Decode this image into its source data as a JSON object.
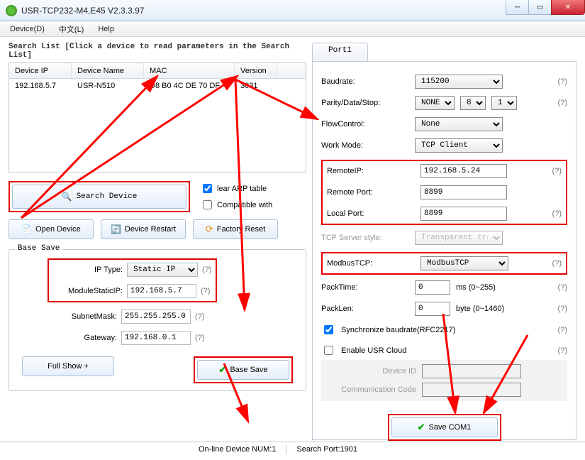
{
  "window": {
    "title": "USR-TCP232-M4,E45 V2.3.3.97"
  },
  "menu": {
    "device": "Device(D)",
    "lang": "中文(L)",
    "help": "Help"
  },
  "searchlist_label": "Search List [Click a device to read parameters in the Search List]",
  "columns": {
    "ip": "Device IP",
    "name": "Device Name",
    "mac": "MAC",
    "ver": "Version"
  },
  "row": {
    "ip": "192.168.5.7",
    "name": "USR-N510",
    "mac": "D8 B0 4C DE 70 DF",
    "ver": "3031"
  },
  "buttons": {
    "search": "Search Device",
    "open": "Open Device",
    "restart": "Device Restart",
    "factory": "Factory Reset",
    "fullshow": "Full Show  +",
    "basesave": "Base Save",
    "savecom": "Save COM1"
  },
  "checks": {
    "arp": "lear ARP table",
    "compat": "Compatible with"
  },
  "base": {
    "title": "Base Save",
    "iptype_label": "IP   Type:",
    "iptype_value": "Static IP",
    "static_label": "ModuleStaticIP:",
    "static_value": "192.168.5.7",
    "mask_label": "SubnetMask:",
    "mask_value": "255.255.255.0",
    "gw_label": "Gateway:",
    "gw_value": "192.168.0.1"
  },
  "port": {
    "tab": "Port1",
    "baud_l": "Baudrate:",
    "baud_v": "115200",
    "pds_l": "Parity/Data/Stop:",
    "parity_v": "NONE",
    "data_v": "8",
    "stop_v": "1",
    "flow_l": "FlowControl:",
    "flow_v": "None",
    "work_l": "Work Mode:",
    "work_v": "TCP Client",
    "rip_l": "RemoteIP:",
    "rip_v": "192.168.5.24",
    "rport_l": "Remote Port:",
    "rport_v": "8899",
    "lport_l": "Local Port:",
    "lport_v": "8899",
    "tss_l": "TCP Server style:",
    "tss_v": "Transparent transmi",
    "mtcp_l": "ModbusTCP:",
    "mtcp_v": "ModbusTCP",
    "pt_l": "PackTime:",
    "pt_v": "0",
    "pt_u": "ms (0~255)",
    "pl_l": "PackLen:",
    "pl_v": "0",
    "pl_u": "byte (0~1460)",
    "sync_l": "Synchronize baudrate(RFC2217)",
    "cloud_l": "Enable USR Cloud",
    "devid_l": "Device ID",
    "devid_v": "",
    "commc_l": "Communication Code",
    "commc_v": ""
  },
  "status": {
    "online": "On-line Device NUM:1",
    "port": "Search Port:1901"
  }
}
